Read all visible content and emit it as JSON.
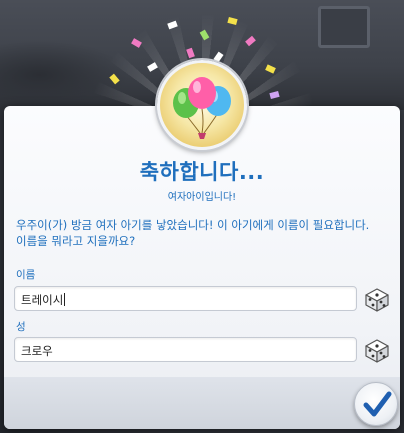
{
  "dialog": {
    "title": "축하합니다...",
    "subtitle": "여자아이입니다!",
    "message": "우주이(가) 방금 여자 아기를 낳았습니다! 이 아기에게 이름이 필요합니다. 이름을 뭐라고 지을까요?"
  },
  "fields": {
    "first_name": {
      "label": "이름",
      "value": "트레이시"
    },
    "last_name": {
      "label": "성",
      "value": "크로우"
    }
  },
  "icons": {
    "emblem": "balloons-icon",
    "randomize": "dice-icon",
    "confirm": "checkmark-icon"
  },
  "colors": {
    "accent": "#1f6fbd",
    "balloon_green": "#5cc14a",
    "balloon_pink": "#ff5fa8",
    "balloon_blue": "#4fb8f0",
    "emblem_gold": "#e9c96a"
  }
}
